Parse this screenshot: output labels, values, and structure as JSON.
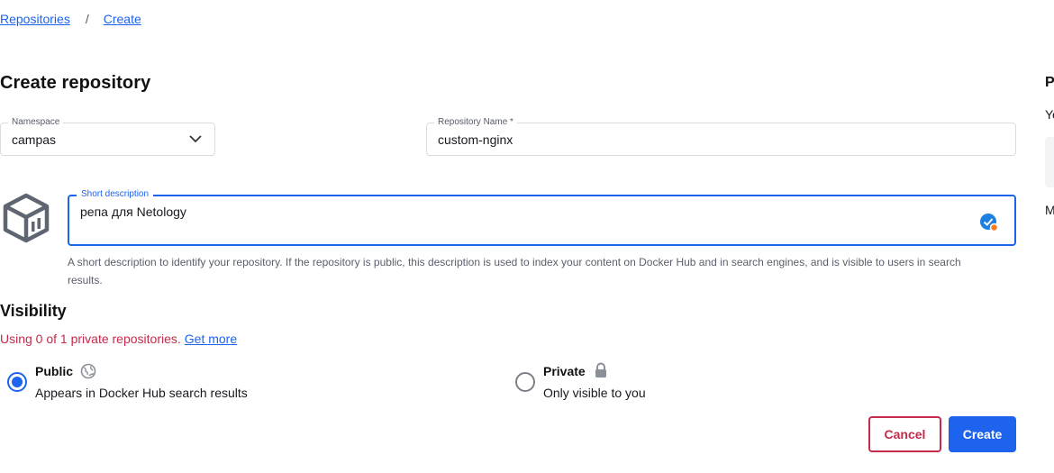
{
  "breadcrumb": {
    "root": "Repositories",
    "separator": "/",
    "current": "Create"
  },
  "page_title": "Create repository",
  "namespace": {
    "label": "Namespace",
    "value": "campas",
    "icon": "chevron-down-icon"
  },
  "repo_name": {
    "label": "Repository Name *",
    "value": "custom-nginx"
  },
  "description": {
    "label": "Short description",
    "value": "репа для Netology",
    "help": "A short description to identify your repository. If the repository is public, this description is used to index your content on Docker Hub and in search engines, and is visible to users in search results."
  },
  "visibility": {
    "title": "Visibility",
    "usage_text": "Using 0 of 1 private repositories.",
    "usage_link": "Get more",
    "options": [
      {
        "title": "Public",
        "subtitle": "Appears in Docker Hub search results",
        "icon": "globe-icon",
        "selected": true
      },
      {
        "title": "Private",
        "subtitle": "Only visible to you",
        "icon": "lock-icon",
        "selected": false
      }
    ]
  },
  "actions": {
    "cancel": "Cancel",
    "create": "Create"
  },
  "side_panel": {
    "heading": "P",
    "line1": "Yo",
    "line2": "M"
  },
  "colors": {
    "accent": "#1d63ed",
    "danger": "#c62a4a",
    "border": "#d9dbe0"
  }
}
